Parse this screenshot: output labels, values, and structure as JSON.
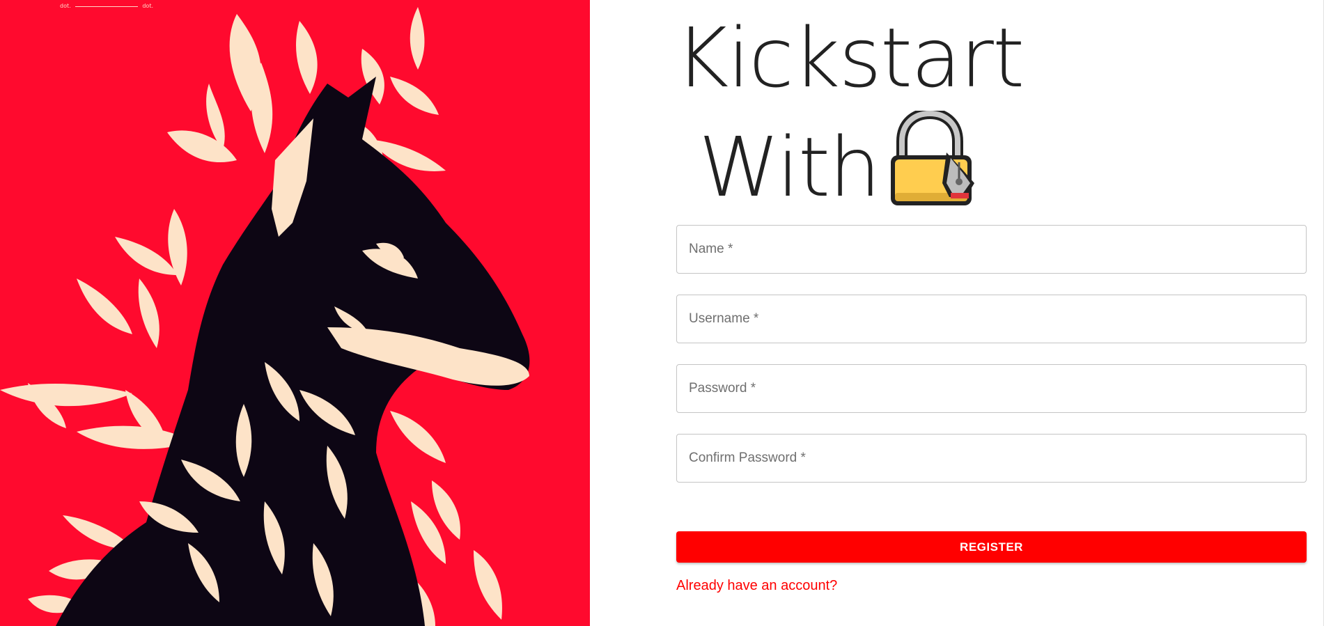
{
  "art": {
    "caption_left": "dot.",
    "caption_right": "dot.",
    "background_color": "#ff0a2e",
    "image_icon": "doberman-with-leaves-illustration"
  },
  "heading": {
    "line1": "Kickstart",
    "line2": "With",
    "icon": "locked-with-pen-icon"
  },
  "form": {
    "name_placeholder": "Name *",
    "username_placeholder": "Username *",
    "password_placeholder": "Password *",
    "confirm_placeholder": "Confirm Password *",
    "register_label": "REGISTER",
    "login_link": "Already have an account?"
  },
  "colors": {
    "accent": "#ff0000",
    "text": "#222222"
  }
}
